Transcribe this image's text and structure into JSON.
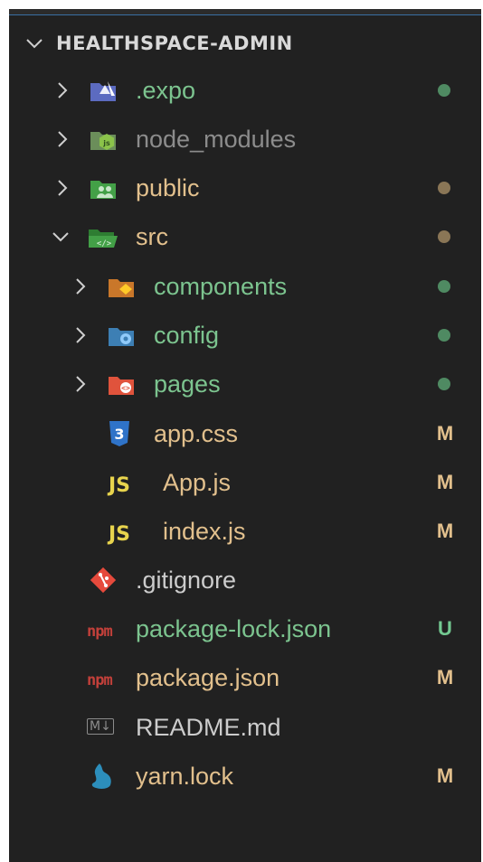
{
  "explorer": {
    "title": "HEALTHSPACE-ADMIN",
    "items": [
      {
        "name": ".expo",
        "color": "#7cc48f",
        "status": "dot-green"
      },
      {
        "name": "node_modules",
        "color": "#8c8c8c",
        "status": ""
      },
      {
        "name": "public",
        "color": "#e2c08d",
        "status": "dot-olive"
      },
      {
        "name": "src",
        "color": "#e2c08d",
        "status": "dot-olive"
      },
      {
        "name": "components",
        "color": "#7cc48f",
        "status": "dot-green"
      },
      {
        "name": "config",
        "color": "#7cc48f",
        "status": "dot-green"
      },
      {
        "name": "pages",
        "color": "#7cc48f",
        "status": "dot-green"
      },
      {
        "name": "app.css",
        "color": "#e2c08d",
        "status": "M"
      },
      {
        "name": "App.js",
        "color": "#e2c08d",
        "status": "M"
      },
      {
        "name": "index.js",
        "color": "#e2c08d",
        "status": "M"
      },
      {
        "name": ".gitignore",
        "color": "#cccccc",
        "status": ""
      },
      {
        "name": "package-lock.json",
        "color": "#7cc48f",
        "status": "U"
      },
      {
        "name": "package.json",
        "color": "#e2c08d",
        "status": "M"
      },
      {
        "name": "README.md",
        "color": "#cccccc",
        "status": ""
      },
      {
        "name": "yarn.lock",
        "color": "#e2c08d",
        "status": "M"
      }
    ],
    "icons": {
      "expo": "expo-folder-icon",
      "node_modules": "node-folder-icon",
      "public": "public-folder-icon",
      "src": "src-folder-open-icon",
      "components": "components-folder-icon",
      "config": "config-folder-icon",
      "pages": "pages-folder-icon",
      "css": "css3-icon",
      "js": "javascript-icon",
      "git": "git-icon",
      "npm": "npm-icon",
      "markdown": "markdown-icon",
      "yarn": "yarn-icon"
    },
    "js_icon_text": "JS",
    "css_icon_text": "3",
    "md_icon_text": "M↓",
    "npm_icon_text": "npm"
  }
}
